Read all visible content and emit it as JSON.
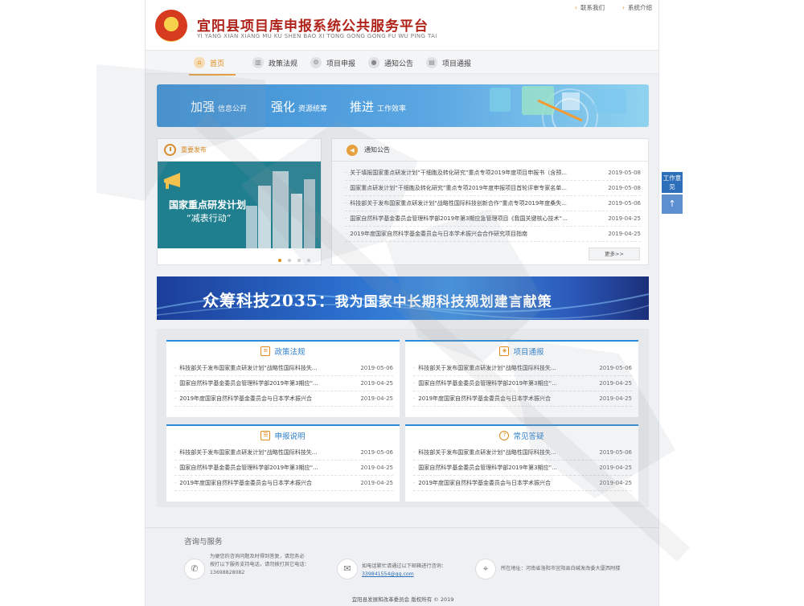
{
  "header": {
    "title_cn": "宜阳县项目库申报系统公共服务平台",
    "title_en": "YI YANG XIAN XIANG MU KU SHEN BAO XI TONG GONG GONG FU WU PING TAI",
    "links": [
      "联系我们",
      "系统介绍"
    ]
  },
  "nav": [
    {
      "label": "首页",
      "icon": "home-icon",
      "active": true
    },
    {
      "label": "政策法规",
      "icon": "chart-icon",
      "active": false
    },
    {
      "label": "项目申报",
      "icon": "gear-icon",
      "active": false
    },
    {
      "label": "通知公告",
      "icon": "user-icon",
      "active": false
    },
    {
      "label": "项目通报",
      "icon": "message-icon",
      "active": false
    }
  ],
  "banner1": {
    "items": [
      {
        "big": "加强",
        "small": "信息公开"
      },
      {
        "big": "强化",
        "small": "资源统筹"
      },
      {
        "big": "推进",
        "small": "工作效率"
      }
    ]
  },
  "important": {
    "title": "重要发布",
    "image_line1": "国家重点研发计划",
    "image_line2": "“减表行动”"
  },
  "notice": {
    "title": "通知公告",
    "more": "更多>>",
    "rows": [
      {
        "text": "关于填报国家重点研发计划“干细胞及转化研究”重点专项2019年度项目申报书（含预...",
        "date": "2019-05-08"
      },
      {
        "text": "国家重点研发计划“干细胞及转化研究”重点专项2019年度申报项目首轮评审专家名单...",
        "date": "2019-05-08"
      },
      {
        "text": "科技部关于发布国家重点研发计划“战略性国际科技创新合作”重点专项2019年度桑失...",
        "date": "2019-05-06"
      },
      {
        "text": "国家自然科学基金委员会管理科学部2019年第3期应急管理项目《我国关键核心技术“...",
        "date": "2019-04-25"
      },
      {
        "text": "2019年度国家自然科学基金委员会与日本学术振兴会合作研究项目指南",
        "date": "2019-04-25"
      }
    ]
  },
  "banner2": {
    "part1": "众筹科技2035：",
    "part2": "我为国家中长期科技规划建言献策"
  },
  "cards": [
    {
      "title": "政策法规",
      "icon": "document-icon",
      "rows": [
        {
          "text": "科技部关于发布国家重点研发计划“战略性国际科技失...",
          "date": "2019-05-06"
        },
        {
          "text": "国家自然科学基金委员会管理科学部2019年第3期应“...",
          "date": "2019-04-25"
        },
        {
          "text": "2019年度国家自然科学基金委员会与日本学术振兴合",
          "date": "2019-04-25"
        }
      ]
    },
    {
      "title": "项目通报",
      "icon": "layers-icon",
      "rows": [
        {
          "text": "科技部关于发布国家重点研发计划“战略性国际科技失...",
          "date": "2019-05-06"
        },
        {
          "text": "国家自然科学基金委员会管理科学部2019年第3期应“...",
          "date": "2019-04-25"
        },
        {
          "text": "2019年度国家自然科学基金委员会与日本学术振兴合",
          "date": "2019-04-25"
        }
      ]
    },
    {
      "title": "申报说明",
      "icon": "list-icon",
      "rows": [
        {
          "text": "科技部关于发布国家重点研发计划“战略性国际科技失...",
          "date": "2019-05-06"
        },
        {
          "text": "国家自然科学基金委员会管理科学部2019年第3期应“...",
          "date": "2019-04-25"
        },
        {
          "text": "2019年度国家自然科学基金委员会与日本学术振兴合",
          "date": "2019-04-25"
        }
      ]
    },
    {
      "title": "常见答疑",
      "icon": "question-icon",
      "rows": [
        {
          "text": "科技部关于发布国家重点研发计划“战略性国际科技失...",
          "date": "2019-05-06"
        },
        {
          "text": "国家自然科学基金委员会管理科学部2019年第3期应“...",
          "date": "2019-04-25"
        },
        {
          "text": "2019年度国家自然科学基金委员会与日本学术振兴合",
          "date": "2019-04-25"
        }
      ]
    }
  ],
  "footer": {
    "title": "咨询与服务",
    "phone_lines": [
      "为便您的咨询问题及时得到答复，请您务必",
      "按打以下服务支持电话，请勿拨打其它电话：",
      "13698828082"
    ],
    "email_lines": [
      "如电话繁忙请通过以下邮箱进行咨询：",
      "339841554@qq.com"
    ],
    "address": "所在地址：河南省洛阳市宜阳县白碱发改委大厦西附楼",
    "copyright": "宜阳县发展和改革委员会 版权所有 © 2019"
  },
  "side": {
    "feedback": "工作意见",
    "up": "↑"
  },
  "colors": {
    "accent": "#e08a1a",
    "blue": "#2c8bd6",
    "title_red": "#b0231a"
  }
}
